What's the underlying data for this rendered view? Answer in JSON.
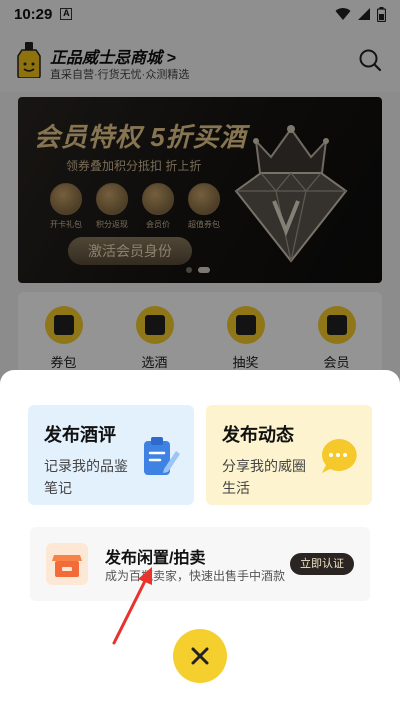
{
  "status_bar": {
    "time": "10:29",
    "notif_glyph": "A"
  },
  "header": {
    "title": "正品威士忌商城 >",
    "subtitle": "直采自营·行货无忧·众测精选"
  },
  "banner": {
    "title": "会员特权 5折买酒",
    "subtitle": "领券叠加积分抵扣 折上折",
    "perks": [
      {
        "label": "开卡礼包",
        "icon": "gift-icon"
      },
      {
        "label": "积分返现",
        "icon": "coin-icon"
      },
      {
        "label": "会员价",
        "icon": "discount-95-icon"
      },
      {
        "label": "超值券包",
        "icon": "coupon-icon"
      }
    ],
    "button_label": "激活会员身份",
    "carousel_index": 2,
    "carousel_count": 2
  },
  "nav": [
    {
      "label": "券包",
      "icon": "coupon-bottle-icon"
    },
    {
      "label": "选酒",
      "icon": "wine-select-icon"
    },
    {
      "label": "抽奖",
      "icon": "lottery-box-icon"
    },
    {
      "label": "会员",
      "icon": "vip-diamond-icon"
    }
  ],
  "sheet": {
    "review_card": {
      "title": "发布酒评",
      "desc": "记录我的品鉴笔记",
      "icon": "clipboard-pen-icon"
    },
    "moment_card": {
      "title": "发布动态",
      "desc": "分享我的威圈生活",
      "icon": "chat-bubble-icon"
    },
    "trade_card": {
      "title": "发布闲置/拍卖",
      "desc": "成为百瓶卖家，快速出售手中酒款",
      "button": "立即认证",
      "icon": "shop-icon"
    },
    "close_icon": "close-icon"
  },
  "colors": {
    "accent_yellow": "#f5cf2e",
    "review_bg": "#e3f1fd",
    "moment_bg": "#fdf3cf",
    "annotation_arrow": "#e8322a"
  }
}
